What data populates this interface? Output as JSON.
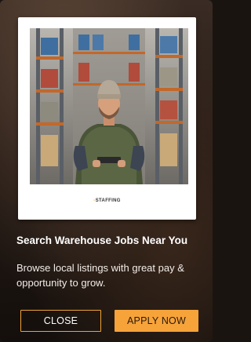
{
  "ad": {
    "logo_mark": "▫",
    "logo_text": "STAFFING",
    "headline": "Search Warehouse Jobs Near You",
    "body": "Browse local listings with great pay & opportunity to grow.",
    "close_label": "CLOSE",
    "apply_label": "APPLY NOW"
  },
  "colors": {
    "accent": "#f6a33a",
    "border_accent": "#f0a238",
    "text": "#ffffff"
  }
}
